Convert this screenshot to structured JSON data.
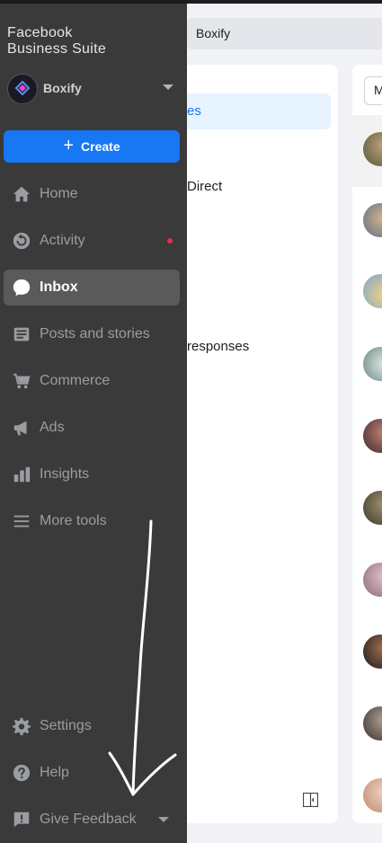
{
  "app": {
    "title_line1": "Facebook",
    "title_line2": "Business Suite"
  },
  "account": {
    "name": "Boxify",
    "logo_text": "BOXIFY"
  },
  "sidebar": {
    "create_label": "Create",
    "items": [
      {
        "label": "Home",
        "icon": "home-icon",
        "active": false
      },
      {
        "label": "Activity",
        "icon": "activity-icon",
        "active": false,
        "has_notification": true
      },
      {
        "label": "Inbox",
        "icon": "chat-bubble-icon",
        "active": true
      },
      {
        "label": "Posts and stories",
        "icon": "posts-icon",
        "active": false
      },
      {
        "label": "Commerce",
        "icon": "cart-icon",
        "active": false
      },
      {
        "label": "Ads",
        "icon": "megaphone-icon",
        "active": false
      },
      {
        "label": "Insights",
        "icon": "bar-chart-icon",
        "active": false
      },
      {
        "label": "More tools",
        "icon": "menu-icon",
        "active": false
      }
    ],
    "bottom_items": [
      {
        "label": "Settings",
        "icon": "gear-icon"
      },
      {
        "label": "Help",
        "icon": "question-icon"
      },
      {
        "label": "Give Feedback",
        "icon": "feedback-icon"
      }
    ]
  },
  "background": {
    "breadcrumb": "Boxify",
    "folders": {
      "selected_fragment": "es",
      "fragment_direct": "Direct",
      "fragment_responses": "responses"
    },
    "search_fragment": "M"
  },
  "colors": {
    "accent": "#1877f2",
    "sidebar_bg": "#3a3a3a",
    "notification": "#f02849"
  }
}
